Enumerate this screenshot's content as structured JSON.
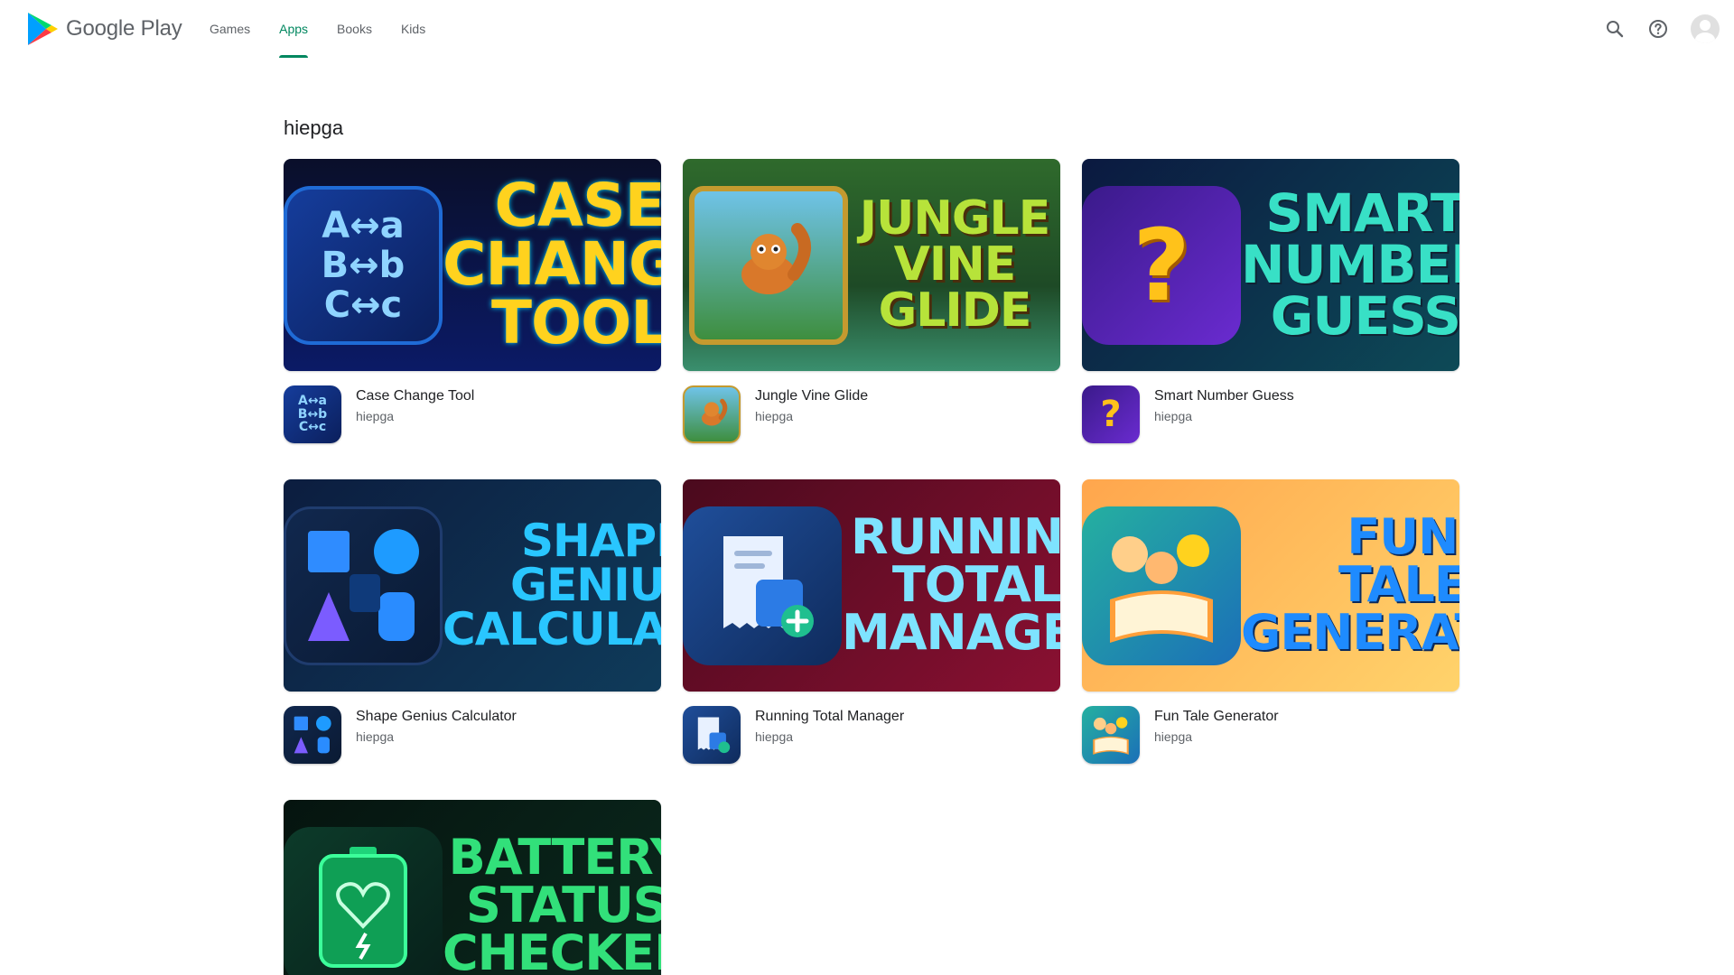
{
  "header": {
    "logo_text": "Google Play",
    "tabs": [
      {
        "label": "Games",
        "active": false
      },
      {
        "label": "Apps",
        "active": true
      },
      {
        "label": "Books",
        "active": false
      },
      {
        "label": "Kids",
        "active": false
      }
    ],
    "icons": [
      "search-icon",
      "help-icon",
      "account-avatar"
    ]
  },
  "accent_color": "#01875f",
  "developer_title": "hiepga",
  "apps": [
    {
      "banner_title": "Case\nChange\nTool",
      "name": "Case Change Tool",
      "developer": "hiepga"
    },
    {
      "banner_title": "Jungle\nVine\nGlide",
      "name": "Jungle Vine Glide",
      "developer": "hiepga"
    },
    {
      "banner_title": "Smart\nNumber\nGuess",
      "name": "Smart Number Guess",
      "developer": "hiepga"
    },
    {
      "banner_title": "Shape\nGenius\nCalculator",
      "name": "Shape Genius Calculator",
      "developer": "hiepga"
    },
    {
      "banner_title": "Running\nTotal\nManager",
      "name": "Running Total Manager",
      "developer": "hiepga"
    },
    {
      "banner_title": "Fun\nTale\nGenerator",
      "name": "Fun Tale Generator",
      "developer": "hiepga"
    },
    {
      "banner_title": "Battery\nStatus\nChecker",
      "name": "",
      "developer": ""
    }
  ]
}
